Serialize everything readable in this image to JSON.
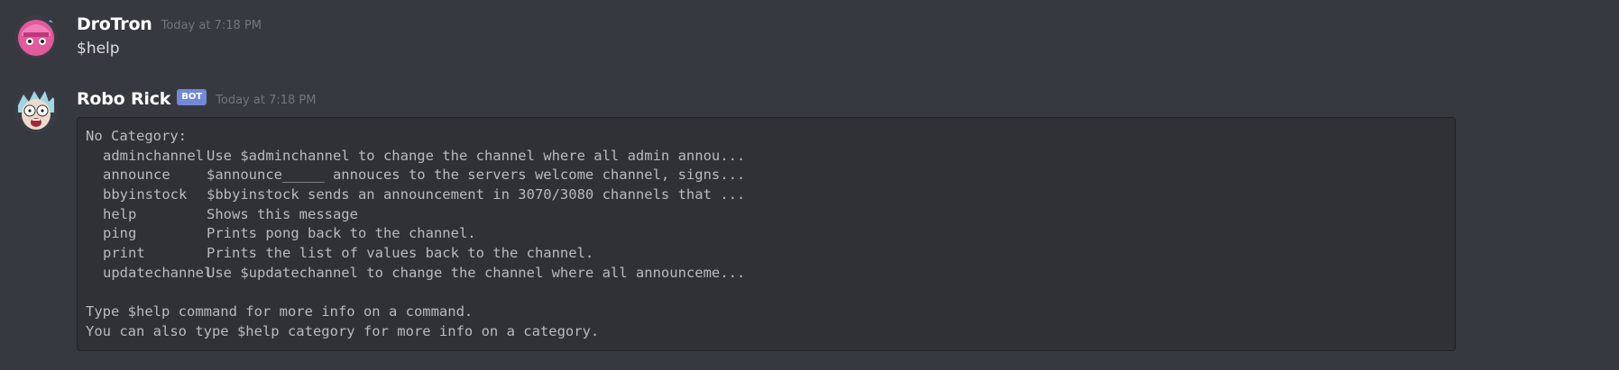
{
  "messages": [
    {
      "username": "DroTron",
      "timestamp": "Today at 7:18 PM",
      "text": "$help",
      "avatar_icon": "pink-character-avatar-icon"
    },
    {
      "username": "Robo Rick",
      "bot_tag": "BOT",
      "timestamp": "Today at 7:18 PM",
      "avatar_icon": "rick-character-avatar-icon",
      "code": {
        "heading": "No Category:",
        "commands": [
          {
            "name": "adminchannel",
            "description": "Use $adminchannel to change the channel where all admin annou..."
          },
          {
            "name": "announce",
            "description": "$announce_____ annouces to the servers welcome channel, signs..."
          },
          {
            "name": "bbyinstock",
            "description": "$bbyinstock sends an announcement in 3070/3080 channels that ..."
          },
          {
            "name": "help",
            "description": "Shows this message"
          },
          {
            "name": "ping",
            "description": "Prints pong back to the channel."
          },
          {
            "name": "print",
            "description": "Prints the list of values back to the channel."
          },
          {
            "name": "updatechannel",
            "description": "Use $updatechannel to change the channel where all announceme..."
          }
        ],
        "footer_1": "Type $help command for more info on a command.",
        "footer_2": "You can also type $help category for more info on a category."
      }
    }
  ],
  "colors": {
    "background": "#36393f",
    "code_background": "#2f3136",
    "bot_tag": "#7289da",
    "timestamp": "#72767d",
    "text": "#dcddde"
  }
}
